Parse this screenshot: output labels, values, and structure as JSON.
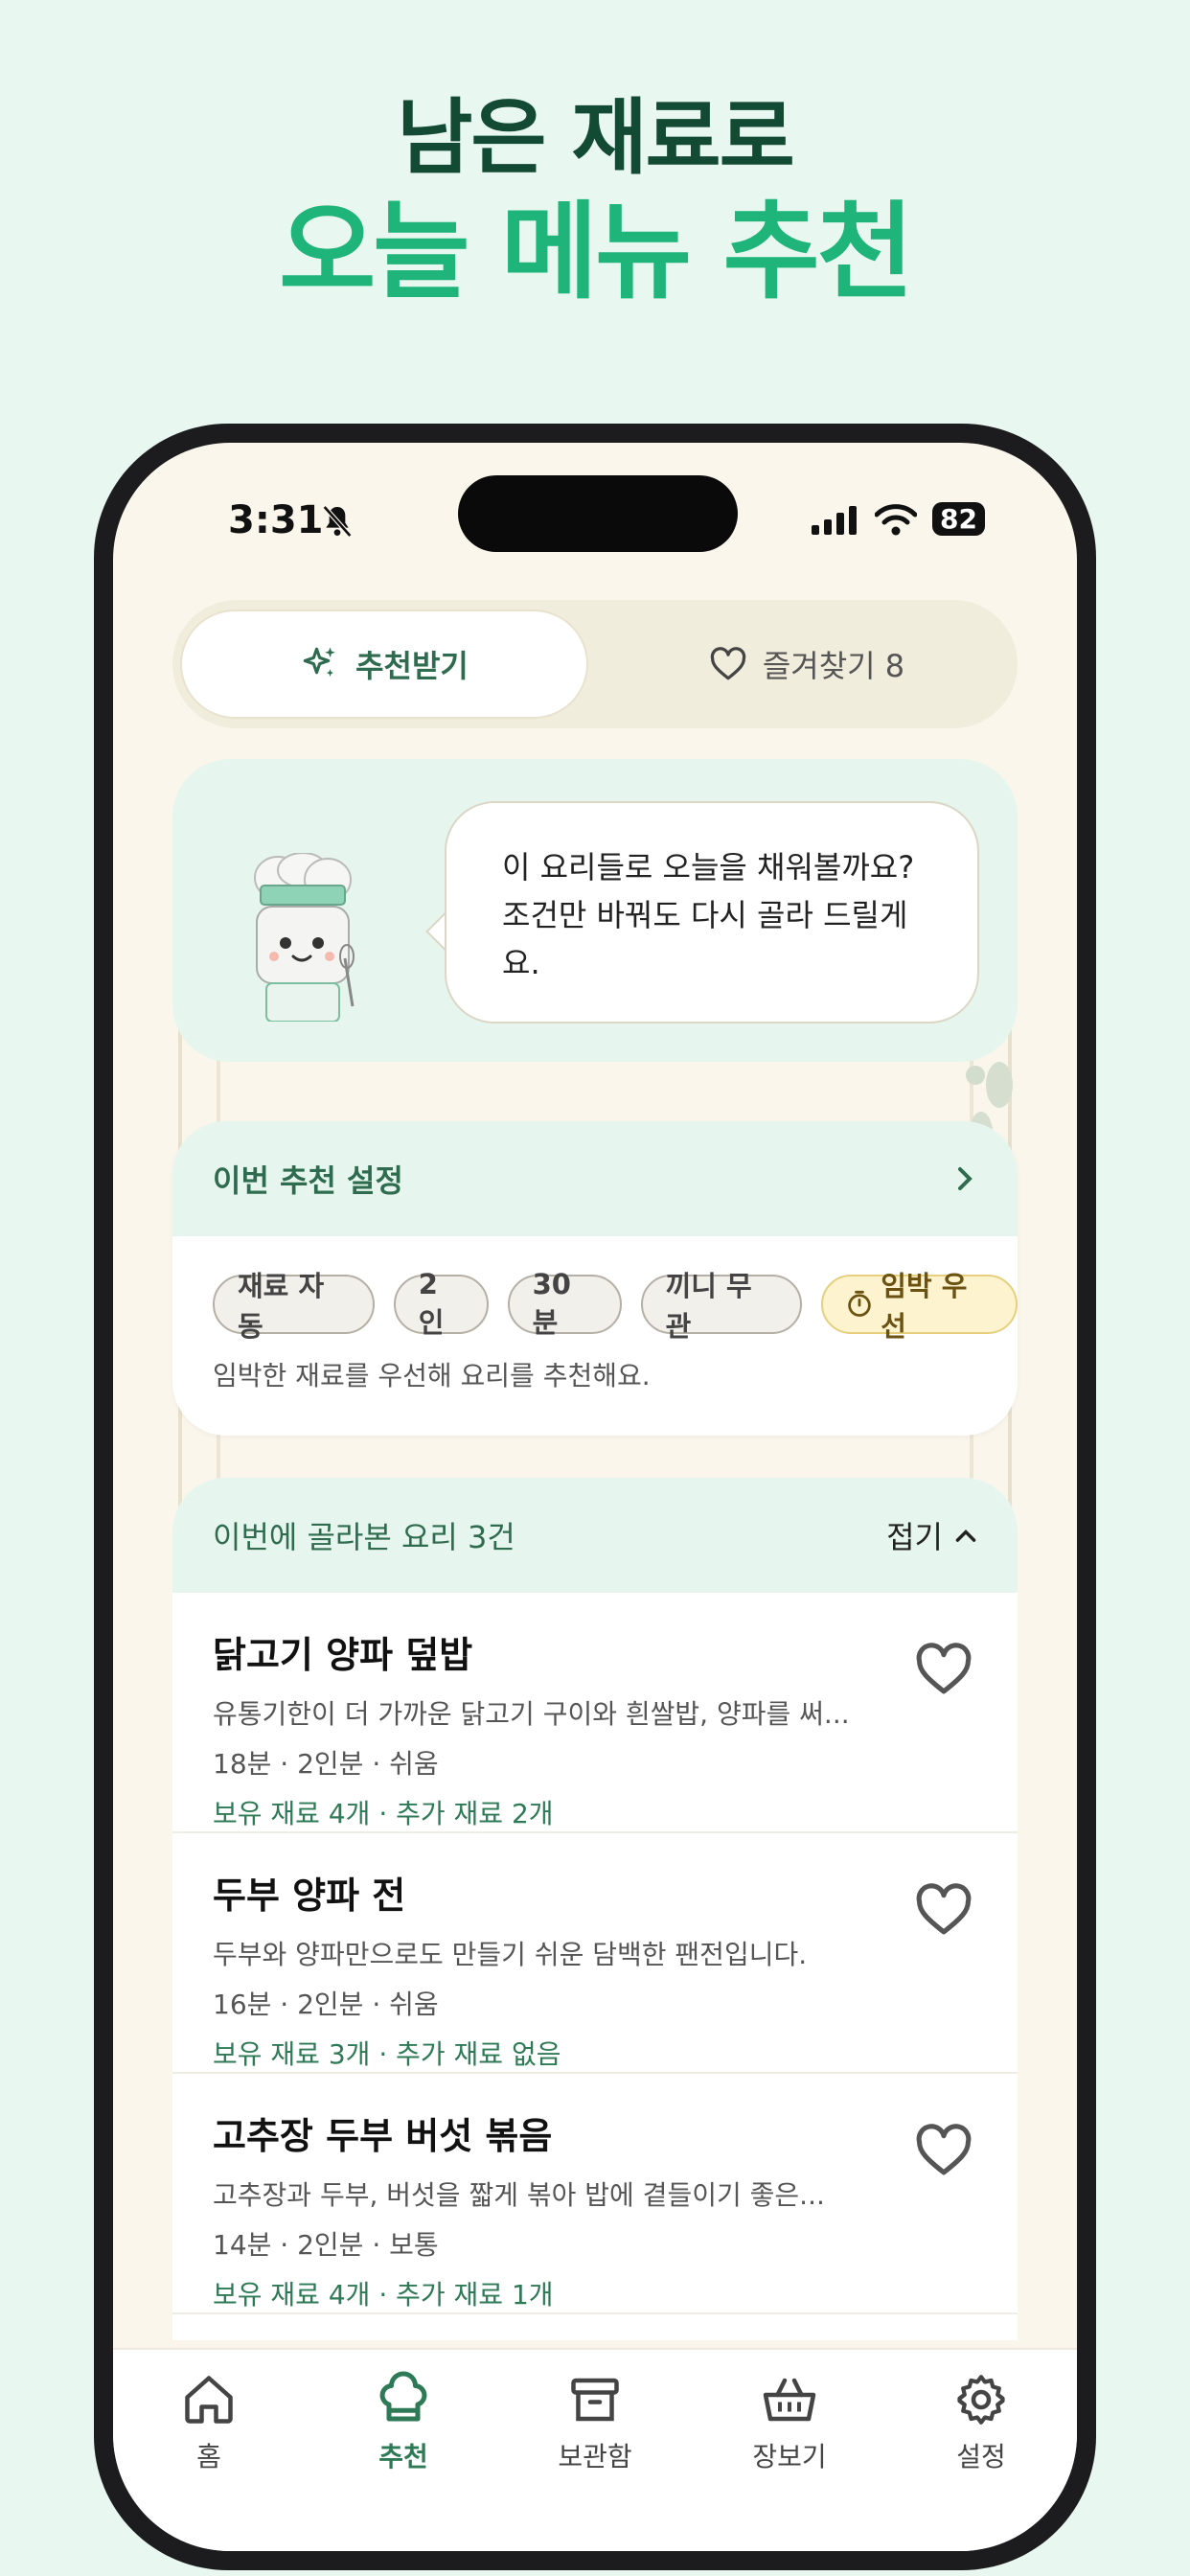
{
  "hero": {
    "line1": "남은 재료로",
    "line2": "오늘 메뉴 추천"
  },
  "status_bar": {
    "time": "3:31",
    "battery": "82"
  },
  "segmented": {
    "recommend_label": "추천받기",
    "favorites_label": "즐겨찾기 8"
  },
  "chef_message": "이 요리들로 오늘을 채워볼까요? 조건만 바꿔도 다시 골라 드릴게요.",
  "settings": {
    "title": "이번 추천 설정",
    "chips": [
      "재료 자동",
      "2인",
      "30분",
      "끼니 무관",
      "임박 우선"
    ],
    "description": "임박한 재료를 우선해 요리를 추천해요."
  },
  "recipes": {
    "header": "이번에 골라본 요리 3건",
    "fold_label": "접기",
    "items": [
      {
        "name": "닭고기 양파 덮밥",
        "desc": "유통기한이 더 가까운 닭고기 구이와 흰쌀밥, 양파를 써...",
        "meta": "18분 · 2인분 · 쉬움",
        "stock": "보유 재료 4개 · 추가 재료 2개"
      },
      {
        "name": "두부 양파 전",
        "desc": "두부와 양파만으로도 만들기 쉬운 담백한 팬전입니다.",
        "meta": "16분 · 2인분 · 쉬움",
        "stock": "보유 재료 3개 · 추가 재료 없음"
      },
      {
        "name": "고추장 두부 버섯 볶음",
        "desc": "고추장과 두부, 버섯을 짧게 볶아 밥에 곁들이기 좋은...",
        "meta": "14분 · 2인분 · 보통",
        "stock": "보유 재료 4개 · 추가 재료 1개"
      }
    ]
  },
  "tabbar": {
    "home": "홈",
    "recommend": "추천",
    "storage": "보관함",
    "shopping": "장보기",
    "settings": "설정"
  },
  "colors": {
    "background": "#e8f8f0",
    "accent_green": "#1fb47a",
    "dark_green": "#134a34",
    "card_mint": "#e6f6ee",
    "warn_yellow": "#fdf3cf"
  }
}
